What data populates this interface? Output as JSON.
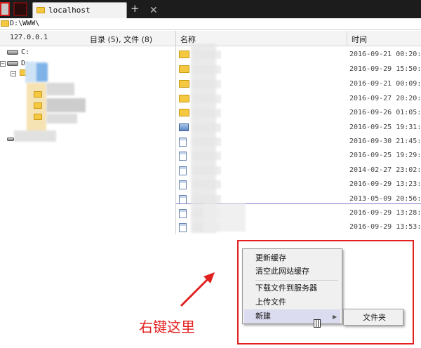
{
  "tab": {
    "title": "localhost"
  },
  "path": "D:\\WWW\\",
  "left_panel": {
    "server": "127.0.0.1",
    "summary": "目录 (5), 文件 (8)",
    "drives": [
      "C:",
      "D:"
    ]
  },
  "file_list": {
    "columns": [
      "名称",
      "时间"
    ],
    "rows": [
      {
        "type": "folder",
        "time": "2016-09-21 00:20:4"
      },
      {
        "type": "folder",
        "time": "2016-09-29 15:50:4"
      },
      {
        "type": "folder",
        "time": "2016-09-21 00:09:3"
      },
      {
        "type": "folder",
        "time": "2016-09-27 20:20:5"
      },
      {
        "type": "folder",
        "time": "2016-09-26 01:05:4"
      },
      {
        "type": "image",
        "time": "2016-09-25 19:31:0"
      },
      {
        "type": "doc",
        "time": "2016-09-30 21:45:4"
      },
      {
        "type": "doc",
        "time": "2016-09-25 19:29:2"
      },
      {
        "type": "doc",
        "time": "2014-02-27 23:02:2"
      },
      {
        "type": "doc",
        "time": "2016-09-29 13:23:4"
      },
      {
        "type": "doc",
        "time": "2013-05-09 20:56:3"
      },
      {
        "type": "doc",
        "time": "2016-09-29 13:28:1"
      },
      {
        "type": "doc",
        "time": "2016-09-29 13:53:5"
      }
    ]
  },
  "context_menu": {
    "items": [
      "更新缓存",
      "清空此网站缓存",
      "下载文件到服务器",
      "上传文件",
      "新建"
    ],
    "submenu": [
      "文件夹"
    ]
  },
  "annotation": {
    "text": "右键这里",
    "color": "#e22020"
  }
}
